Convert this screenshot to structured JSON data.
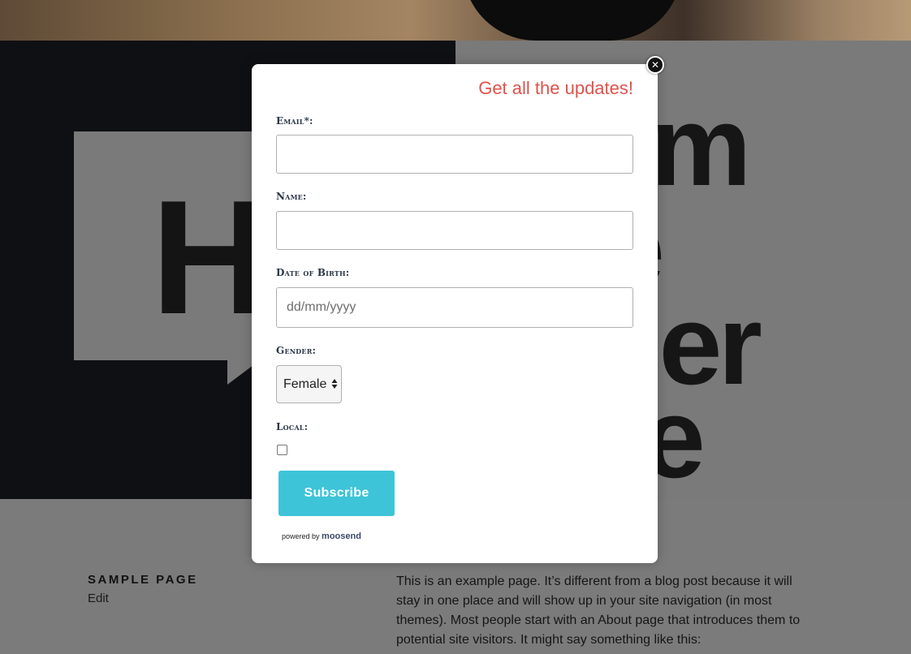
{
  "background_page": {
    "hero_word_left": "H",
    "hero_words_right": [
      "m",
      "e",
      "ner",
      "e"
    ],
    "page_heading": "SAMPLE PAGE",
    "edit_link": "Edit",
    "body_text": "This is an example page. It’s different from a blog post because it will stay in one place and will show up in your site navigation (in most themes). Most people start with an About page that introduces them to potential site visitors. It might say something like this:"
  },
  "modal": {
    "title": "Get all the updates!",
    "close_icon": "close-icon",
    "fields": {
      "email_label": "Email*:",
      "email_value": "",
      "name_label": "Name:",
      "name_value": "",
      "dob_label": "Date of Birth:",
      "dob_placeholder": "dd/mm/yyyy",
      "gender_label": "Gender:",
      "gender_selected": "Female",
      "local_label": "Local:",
      "local_checked": false
    },
    "subscribe_label": "Subscribe",
    "powered_by": "powered by",
    "brand": "moosend"
  },
  "colors": {
    "title": "#e0524a",
    "subscribe_button": "#3ec4d8",
    "overlay": "#7b7b7b"
  }
}
